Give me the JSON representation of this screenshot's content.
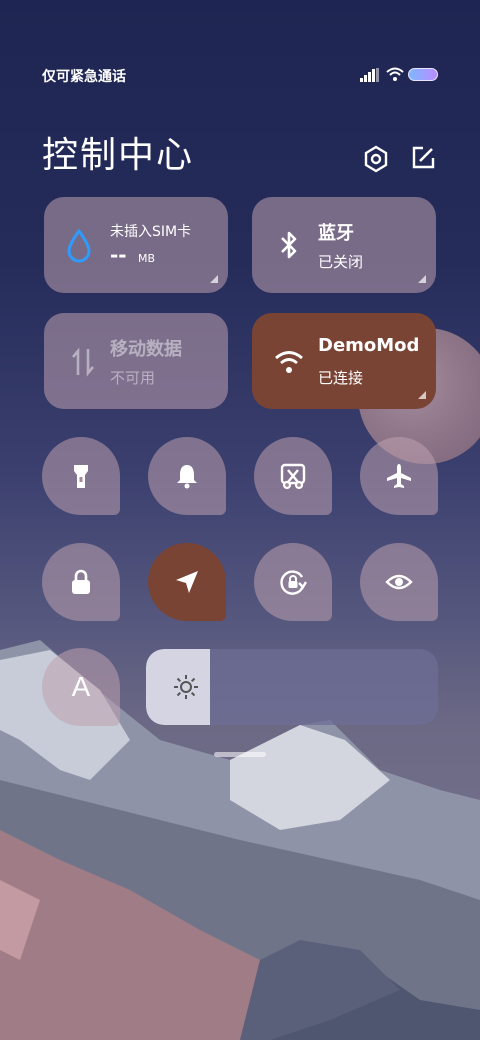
{
  "status": {
    "carrier_text": "仅可紧急通话",
    "signal_icon": "signal-icon",
    "wifi_icon": "wifi-icon",
    "battery_icon": "battery-icon"
  },
  "header": {
    "title": "控制中心",
    "settings_icon": "gear-icon",
    "edit_icon": "edit-icon"
  },
  "tiles": [
    {
      "id": "data-usage",
      "icon": "water-drop-icon",
      "title": "未插入SIM卡",
      "value": "--",
      "unit": "MB",
      "state": "normal"
    },
    {
      "id": "bluetooth",
      "icon": "bluetooth-icon",
      "title": "蓝牙",
      "subtitle": "已关闭",
      "state": "off"
    },
    {
      "id": "mobile-data",
      "icon": "mobile-data-icon",
      "title": "移动数据",
      "subtitle": "不可用",
      "state": "disabled"
    },
    {
      "id": "wlan",
      "icon": "wifi-icon",
      "title": "DemoMod",
      "subtitle": "已连接",
      "state": "on"
    }
  ],
  "toggles": [
    {
      "id": "flashlight",
      "icon": "flashlight-icon",
      "active": false
    },
    {
      "id": "ringer",
      "icon": "bell-icon",
      "active": false
    },
    {
      "id": "screenshot",
      "icon": "scissors-icon",
      "active": false
    },
    {
      "id": "airplane",
      "icon": "airplane-icon",
      "active": false
    },
    {
      "id": "lock-screen",
      "icon": "lock-icon",
      "active": false
    },
    {
      "id": "location",
      "icon": "location-arrow-icon",
      "active": true
    },
    {
      "id": "rotation-lock",
      "icon": "rotation-lock-icon",
      "active": false
    },
    {
      "id": "reading-mode",
      "icon": "eye-icon",
      "active": false
    },
    {
      "id": "auto-brightness",
      "icon": "letter-a-icon",
      "label": "A",
      "active": false
    }
  ],
  "brightness": {
    "level": 0.22,
    "icon": "sun-icon"
  },
  "colors": {
    "active_tile": "#7a4435",
    "inactive_tile": "#a58a9a"
  }
}
